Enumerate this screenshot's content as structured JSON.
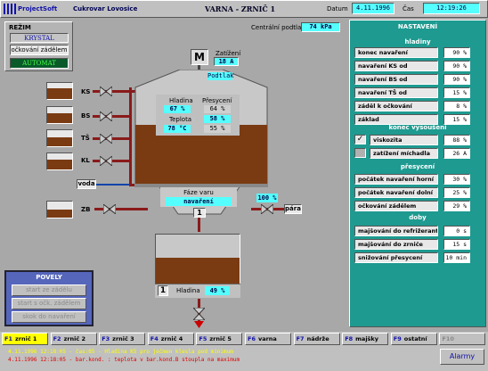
{
  "header": {
    "logo": "ProjectSoft",
    "company": "Cukrovar Lovosice",
    "title": "VARNA  -  ZRNIČ 1",
    "date_label": "Datum",
    "date": "4.11.1996",
    "time_label": "Čas",
    "time": "12:19:26"
  },
  "mode": {
    "title": "REŽIM",
    "item1": "KRYSTAL",
    "item2": "očkování zádělem",
    "item3": "AUTOMAT"
  },
  "tanks": [
    {
      "label": "KS"
    },
    {
      "label": "BS"
    },
    {
      "label": "TŠ"
    },
    {
      "label": "KL"
    }
  ],
  "voda": "voda",
  "zb": "ZB",
  "para": "pára",
  "valve_pct": "100 %",
  "top": {
    "central_label": "Centrální podtlak",
    "central_value": "74 kPa",
    "motor": "M",
    "zatizeni_label": "Zatížení",
    "zatizeni_value": "18 A",
    "podtlak": "Podtlak"
  },
  "pan": {
    "hladina_label": "Hladina",
    "hladina_value": "67 %",
    "presyceni_label": "Přesycení",
    "presyceni_value": "64 %",
    "teplota_label": "Teplota",
    "teplota_value": "78 °C",
    "set1": "58 %",
    "set2": "55 %"
  },
  "phase": {
    "label": "Fáze varu",
    "value": "navaření",
    "num": "1"
  },
  "recv": {
    "num": "1",
    "label": "Hladina",
    "value": "49 %"
  },
  "commands": {
    "title": "POVELY",
    "b1": "start ze zádělu",
    "b2": "start s očk. zádělem",
    "b3": "skok do navaření"
  },
  "settings": {
    "title": "NASTAVENÍ",
    "sec1": "hladiny",
    "rows1": [
      {
        "l": "konec navaření",
        "v": "90 %"
      },
      {
        "l": "navaření KS od",
        "v": "90 %"
      },
      {
        "l": "navaření BS od",
        "v": "90 %"
      },
      {
        "l": "navaření TŠ od",
        "v": "15 %"
      },
      {
        "l": "záděl k očkování",
        "v": "8 %"
      },
      {
        "l": "základ",
        "v": "15 %"
      }
    ],
    "sec2": "konec vysoušení",
    "rows2": [
      {
        "l": "viskozita",
        "v": "88 %"
      },
      {
        "l": "zatížení míchadla",
        "v": "26 A"
      }
    ],
    "sec3": "přesycení",
    "rows3": [
      {
        "l": "počátek navaření horní",
        "v": "30 %"
      },
      {
        "l": "počátek navaření dolní",
        "v": "25 %"
      },
      {
        "l": "očkování zádělem",
        "v": "29 %"
      }
    ],
    "sec4": "doby",
    "rows4": [
      {
        "l": "majšování do refrižerantu",
        "v": "0 s"
      },
      {
        "l": "majšování do zrniče",
        "v": "15 s"
      },
      {
        "l": "snižování přesycení",
        "v": "10 min"
      }
    ]
  },
  "fkeys": [
    {
      "k": "F1",
      "t": "zrnič 1"
    },
    {
      "k": "F2",
      "t": "zrnič 2"
    },
    {
      "k": "F3",
      "t": "zrnič 3"
    },
    {
      "k": "F4",
      "t": "zrnič 4"
    },
    {
      "k": "F5",
      "t": "zrnič 5"
    },
    {
      "k": "F6",
      "t": "varna"
    },
    {
      "k": "F7",
      "t": "nádrže"
    },
    {
      "k": "F8",
      "t": "majšky"
    },
    {
      "k": "F9",
      "t": "ostatní"
    },
    {
      "k": "F10",
      "t": ""
    }
  ],
  "alarms": {
    "line1": "4.11.1996  12:18:05 - čas:05   - Hladina KS pro ječmen klesla pod minimum",
    "line2": "4.11.1996  12:18:05 - bar.kond. : teplota v bar.kond.B stoupla na maximum",
    "button": "Alarmy"
  },
  "colors": {
    "teal": "#1e9a90",
    "cyan": "#55ffff",
    "syrup": "#7a3b13",
    "pipe": "#8a1a1a"
  }
}
